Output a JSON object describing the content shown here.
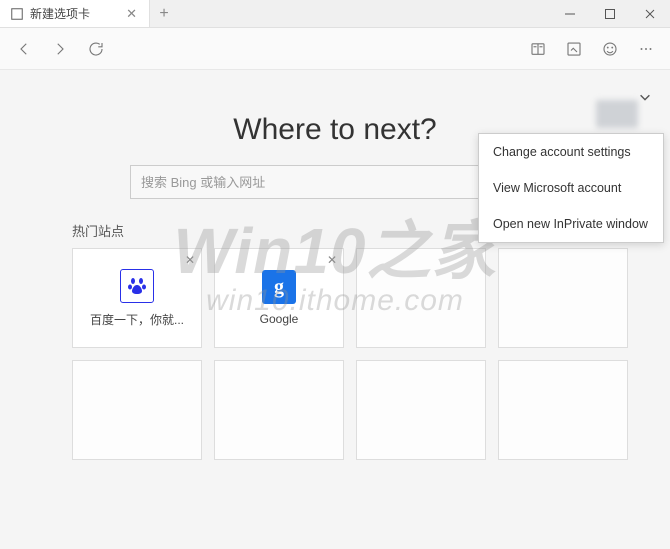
{
  "tab": {
    "title": "新建选项卡"
  },
  "toolbar": {
    "icons": {
      "back": "back",
      "forward": "forward",
      "refresh": "refresh",
      "read": "reading-view",
      "note": "web-note",
      "smile": "feedback",
      "more": "more"
    }
  },
  "page": {
    "heading": "Where to next?",
    "search_placeholder": "搜索 Bing 或输入网址",
    "section_label": "热门站点"
  },
  "tiles": [
    {
      "label": "百度一下，你就...",
      "icon": "baidu"
    },
    {
      "label": "Google",
      "icon": "google"
    }
  ],
  "dropdown": {
    "items": [
      "Change account settings",
      "View Microsoft account",
      "Open new InPrivate window"
    ]
  },
  "watermark": {
    "line1": "Win10之家",
    "line2": "win10.ithome.com"
  }
}
